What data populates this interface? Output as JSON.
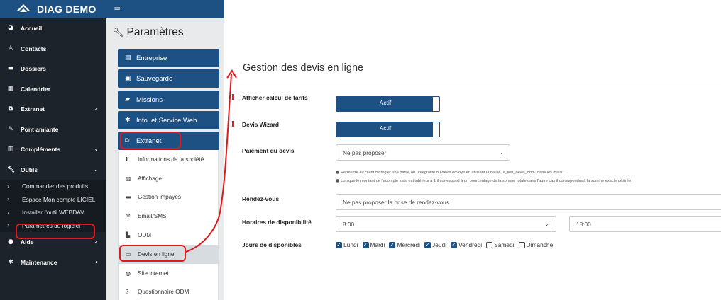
{
  "brand": {
    "name": "DIAG DEMO"
  },
  "sidebar": {
    "items": [
      {
        "label": "Accueil",
        "icon": "dashboard-icon"
      },
      {
        "label": "Contacts",
        "icon": "user-icon"
      },
      {
        "label": "Dossiers",
        "icon": "folder-icon"
      },
      {
        "label": "Calendrier",
        "icon": "calendar-icon"
      },
      {
        "label": "Extranet",
        "icon": "extranet-icon"
      },
      {
        "label": "Pont amiante",
        "icon": "pen-icon"
      },
      {
        "label": "Compléments",
        "icon": "chart-icon"
      },
      {
        "label": "Outils",
        "icon": "wrench-icon"
      }
    ],
    "outils_sub": [
      {
        "label": "Commander des produits"
      },
      {
        "label": "Espace Mon compte LICIEL"
      },
      {
        "label": "Installer l'outil WEBDAV"
      },
      {
        "label": "Paramètres du logiciel"
      }
    ],
    "bottom_items": [
      {
        "label": "Aide",
        "icon": "info-icon"
      },
      {
        "label": "Maintenance",
        "icon": "gear-icon"
      }
    ]
  },
  "settings_panel": {
    "title": "Paramètres",
    "buttons": [
      {
        "label": "Entreprise"
      },
      {
        "label": "Sauvegarde"
      },
      {
        "label": "Missions"
      },
      {
        "label": "Info. et Service Web"
      },
      {
        "label": "Extranet"
      }
    ],
    "extranet_items": [
      {
        "label": "Informations de la société"
      },
      {
        "label": "Affichage"
      },
      {
        "label": "Gestion impayés"
      },
      {
        "label": "Email/SMS"
      },
      {
        "label": "ODM"
      },
      {
        "label": "Devis en ligne"
      },
      {
        "label": "Site internet"
      },
      {
        "label": "Questionnaire ODM"
      }
    ]
  },
  "main": {
    "title": "Gestion des devis en ligne",
    "afficher_calcul": {
      "label": "Afficher calcul de tarifs",
      "state": "Actif"
    },
    "devis_wizard": {
      "label": "Devis Wizard",
      "state": "Actif"
    },
    "paiement": {
      "label": "Paiement du devis",
      "value": "Ne pas proposer",
      "note1": "Permettre au client de régler une partie ou l'intégralité du devis envoyé en utilisant la balise \"li_lien_devis_odm\" dans les mails.",
      "note2": "Lorsque le montant de l'acompte saisi est inférieur à 1 il correspond à un pourcentage de la somme totale dans l'autre cas il correspondra à la somme exacte désirée"
    },
    "rendezvous": {
      "label": "Rendez-vous",
      "value": "Ne pas proposer la prise de rendez-vous"
    },
    "horaires": {
      "label": "Horaires de disponibilité",
      "start": "8:00",
      "end": "18:00"
    },
    "jours": {
      "label": "Jours de disponibles",
      "days": [
        {
          "label": "Lundi",
          "checked": true
        },
        {
          "label": "Mardi",
          "checked": true
        },
        {
          "label": "Mercredi",
          "checked": true
        },
        {
          "label": "Jeudi",
          "checked": true
        },
        {
          "label": "Vendredi",
          "checked": true
        },
        {
          "label": "Samedi",
          "checked": false
        },
        {
          "label": "Dimanche",
          "checked": false
        }
      ]
    }
  },
  "colors": {
    "primary": "#1e5183",
    "sidebar": "#1d232b",
    "highlight": "#e0191b"
  }
}
